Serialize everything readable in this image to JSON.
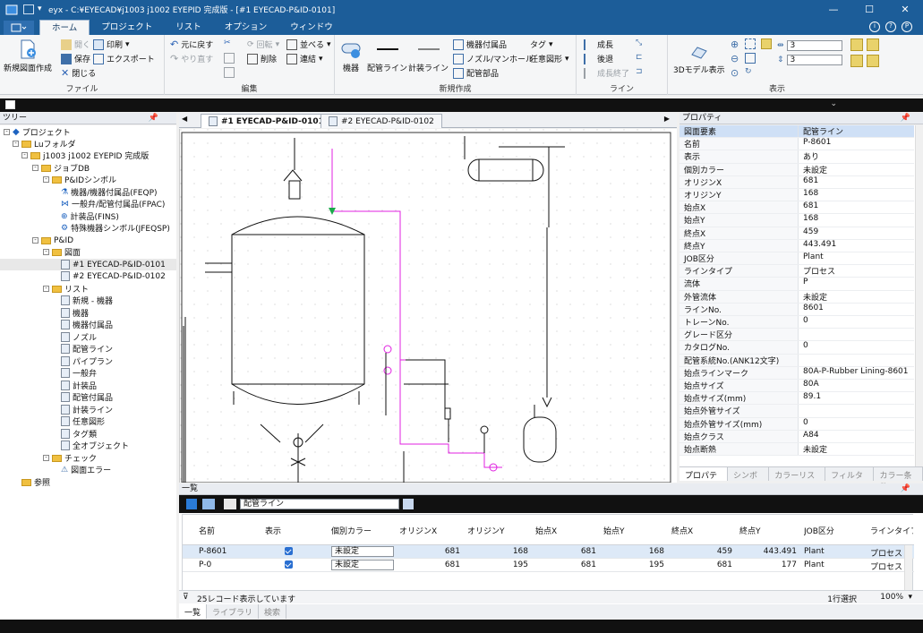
{
  "window": {
    "title": "eyx - C:¥EYECAD¥j1003 j1002 EYEPID 完成版 - [#1 EYECAD-P&ID-0101]",
    "minimize": "—",
    "maximize": "☐",
    "close": "✕"
  },
  "menu": {
    "tabs": [
      "ホーム",
      "プロジェクト",
      "リスト",
      "オプション",
      "ウィンドウ"
    ]
  },
  "ribbon": {
    "new_drawing": "新規図面作成",
    "file": {
      "open": "開く",
      "save": "保存",
      "close": "閉じる",
      "print": "印刷",
      "export": "エクスポート",
      "label": "ファイル"
    },
    "edit": {
      "undo": "元に戻す",
      "redo": "やり直す",
      "rotate": "回転",
      "delete": "削除",
      "arrange": "並べる",
      "link": "連結",
      "label": "編集"
    },
    "create": {
      "equipment": "機器",
      "piping_line": "配管ライン",
      "instrument_line": "計装ライン",
      "equipment_fittings": "機器付属品",
      "nozzle_manhole": "ノズル/マンホール",
      "piping_parts": "配管部品",
      "tag": "タグ",
      "any_shape": "任意図形",
      "label": "新規作成"
    },
    "line": {
      "grow": "成長",
      "back": "後退",
      "grow_end": "成長終了",
      "label": "ライン"
    },
    "view": {
      "model3d": "3Dモデル表示",
      "grid_x": "3",
      "grid_y": "3",
      "label": "表示"
    }
  },
  "tree": {
    "header": "ツリー",
    "items": [
      {
        "label": "プロジェクト"
      },
      {
        "label": "Luフォルダ"
      },
      {
        "label": "j1003 j1002 EYEPID 完成版"
      },
      {
        "label": "ジョブDB"
      },
      {
        "label": "P&IDシンボル"
      },
      {
        "label": "機器/機器付属品(FEQP)"
      },
      {
        "label": "一般弁/配管付属品(FPAC)"
      },
      {
        "label": "計装品(FINS)"
      },
      {
        "label": "特殊機器シンボル(JFEQSP)"
      },
      {
        "label": "P&ID"
      },
      {
        "label": "図面"
      },
      {
        "label": "#1 EYECAD-P&ID-0101"
      },
      {
        "label": "#2 EYECAD-P&ID-0102"
      },
      {
        "label": "リスト"
      },
      {
        "label": "新規 - 機器"
      },
      {
        "label": "機器"
      },
      {
        "label": "機器付属品"
      },
      {
        "label": "ノズル"
      },
      {
        "label": "配管ライン"
      },
      {
        "label": "パイプラン"
      },
      {
        "label": "一般弁"
      },
      {
        "label": "計装品"
      },
      {
        "label": "配管付属品"
      },
      {
        "label": "計装ライン"
      },
      {
        "label": "任意図形"
      },
      {
        "label": "タグ類"
      },
      {
        "label": "全オブジェクト"
      },
      {
        "label": "チェック"
      },
      {
        "label": "図面エラー"
      },
      {
        "label": "参照"
      }
    ]
  },
  "doc_tabs": [
    "#1 EYECAD-P&ID-0101",
    "#2 EYECAD-P&ID-0102"
  ],
  "properties": {
    "header": "プロパティ",
    "rows": [
      {
        "k": "図面要素",
        "v": "配管ライン"
      },
      {
        "k": "名前",
        "v": "P-8601"
      },
      {
        "k": "表示",
        "v": "あり"
      },
      {
        "k": "個別カラー",
        "v": "未設定"
      },
      {
        "k": "オリジンX",
        "v": "681"
      },
      {
        "k": "オリジンY",
        "v": "168"
      },
      {
        "k": "始点X",
        "v": "681"
      },
      {
        "k": "始点Y",
        "v": "168"
      },
      {
        "k": "終点X",
        "v": "459"
      },
      {
        "k": "終点Y",
        "v": "443.491"
      },
      {
        "k": "JOB区分",
        "v": "Plant"
      },
      {
        "k": "ラインタイプ",
        "v": "プロセス"
      },
      {
        "k": "流体",
        "v": "P"
      },
      {
        "k": "外管流体",
        "v": "未設定"
      },
      {
        "k": "ラインNo.",
        "v": "8601"
      },
      {
        "k": "トレーンNo.",
        "v": "0"
      },
      {
        "k": "グレード区分",
        "v": ""
      },
      {
        "k": "カタログNo.",
        "v": "0"
      },
      {
        "k": "配管系統No.(ANK12文字)",
        "v": ""
      },
      {
        "k": "始点ラインマーク",
        "v": "80A-P-Rubber Lining-8601"
      },
      {
        "k": "始点サイズ",
        "v": "80A"
      },
      {
        "k": "始点サイズ(mm)",
        "v": "89.1"
      },
      {
        "k": "始点外管サイズ",
        "v": ""
      },
      {
        "k": "始点外管サイズ(mm)",
        "v": "0"
      },
      {
        "k": "始点クラス",
        "v": "A84"
      },
      {
        "k": "始点断熱",
        "v": "未設定"
      }
    ],
    "tabs": [
      "プロパティ",
      "シンボル",
      "カラーリスト",
      "フィルター",
      "カラー条件"
    ]
  },
  "list": {
    "header": "一覧",
    "selector": "配管ライン",
    "columns": [
      "名前",
      "表示",
      "個別カラー",
      "オリジンX",
      "オリジンY",
      "始点X",
      "始点Y",
      "終点X",
      "終点Y",
      "JOB区分",
      "ラインタイプ"
    ],
    "rows": [
      {
        "name": "P-8601",
        "color": "未設定",
        "ox": "681",
        "oy": "168",
        "sx": "681",
        "sy": "168",
        "ex": "459",
        "ey": "443.491",
        "job": "Plant",
        "type": "プロセス"
      },
      {
        "name": "P-0",
        "color": "未設定",
        "ox": "681",
        "oy": "195",
        "sx": "681",
        "sy": "195",
        "ex": "681",
        "ey": "177",
        "job": "Plant",
        "type": "プロセス"
      }
    ],
    "status_left": "25レコード表示しています",
    "status_right": "1行選択",
    "zoom": "100%",
    "tabs": [
      "一覧",
      "ライブラリ",
      "検索"
    ]
  },
  "colors": {
    "titlebar": "#1c5d99",
    "accent_line": "#e020e0",
    "selection": "#cfe0f6"
  }
}
